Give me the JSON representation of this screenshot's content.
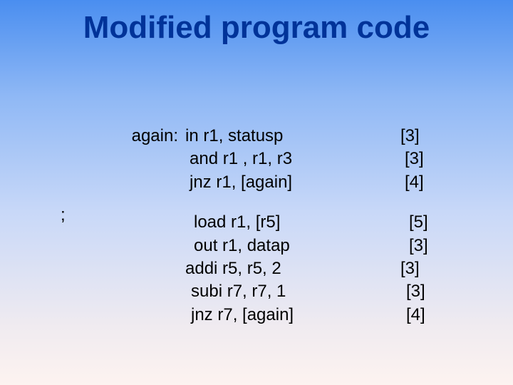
{
  "title": "Modified program code",
  "semicolon": ";",
  "rows1": [
    {
      "label": "again:",
      "instr": "in r1, statusp",
      "cost": "[3]",
      "cls": "indent-in"
    },
    {
      "label": "",
      "instr": "and r1 , r1, r3",
      "cost": "[3]",
      "cls": "indent-and"
    },
    {
      "label": "",
      "instr": "jnz  r1, [again]",
      "cost": "[4]",
      "cls": "indent-jnz"
    }
  ],
  "rows2": [
    {
      "label": "",
      "instr": "load r1, [r5]",
      "cost": "[5]",
      "cls": "indent-load"
    },
    {
      "label": "",
      "instr": "out r1, datap",
      "cost": "[3]",
      "cls": "indent-out"
    },
    {
      "label": "",
      "instr": "addi r5, r5, 2",
      "cost": "[3]",
      "cls": "indent-addi"
    },
    {
      "label": "",
      "instr": "subi r7, r7, 1",
      "cost": "[3]",
      "cls": "indent-subi"
    },
    {
      "label": "",
      "instr": "jnz r7, [again]",
      "cost": "[4]",
      "cls": "indent-jnz2"
    }
  ]
}
